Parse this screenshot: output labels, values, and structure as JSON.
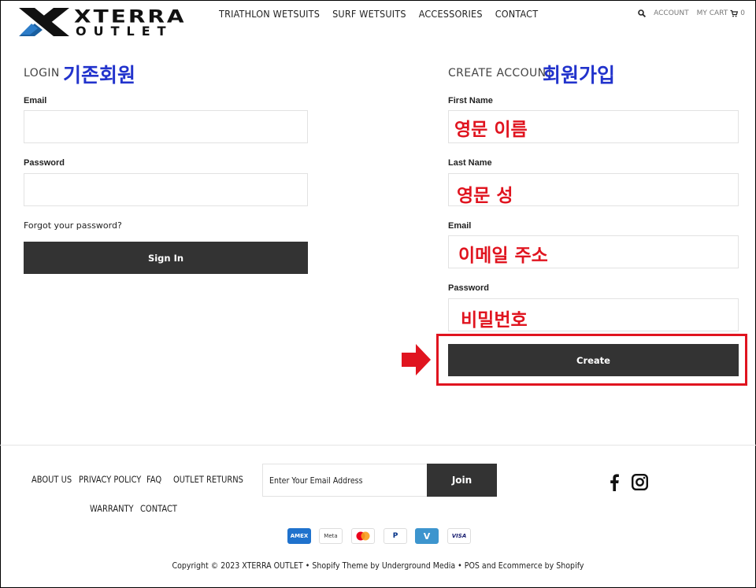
{
  "header": {
    "logo_top": "XTERRA",
    "logo_bottom": "OUTLET",
    "nav": [
      "TRIATHLON WETSUITS",
      "SURF WETSUITS",
      "ACCESSORIES",
      "CONTACT"
    ],
    "account_label": "ACCOUNT",
    "cart_label": "MY CART",
    "cart_count": "0"
  },
  "login": {
    "title": "LOGIN",
    "title_annotation": "기존회원",
    "email_label": "Email",
    "password_label": "Password",
    "forgot_link": "Forgot your password?",
    "sign_in_button": "Sign In"
  },
  "create": {
    "title": "CREATE ACCOUNT",
    "title_annotation": "회원가입",
    "first_name_label": "First Name",
    "first_name_annotation": "영문 이름",
    "last_name_label": "Last Name",
    "last_name_annotation": "영문 성",
    "email_label": "Email",
    "email_annotation": "이메일 주소",
    "password_label": "Password",
    "password_annotation": "비밀번호",
    "create_button": "Create"
  },
  "footer": {
    "links_row1": [
      "ABOUT US",
      "PRIVACY POLICY",
      "FAQ",
      "OUTLET RETURNS"
    ],
    "links_row2": [
      "WARRANTY",
      "CONTACT"
    ],
    "newsletter_placeholder": "Enter Your Email Address",
    "join_button": "Join",
    "social_icons": [
      "facebook-icon",
      "instagram-icon"
    ],
    "payments": [
      "AMEX",
      "Meta",
      "Mastercard",
      "PayPal",
      "V",
      "VISA"
    ],
    "copyright": "Copyright © 2023 XTERRA OUTLET • Shopify Theme by Underground Media • POS and Ecommerce by Shopify"
  },
  "colors": {
    "annotation_blue": "#2233cc",
    "annotation_red": "#e0141f",
    "button_dark": "#333333",
    "logo_blue": "#1a5fa0"
  }
}
